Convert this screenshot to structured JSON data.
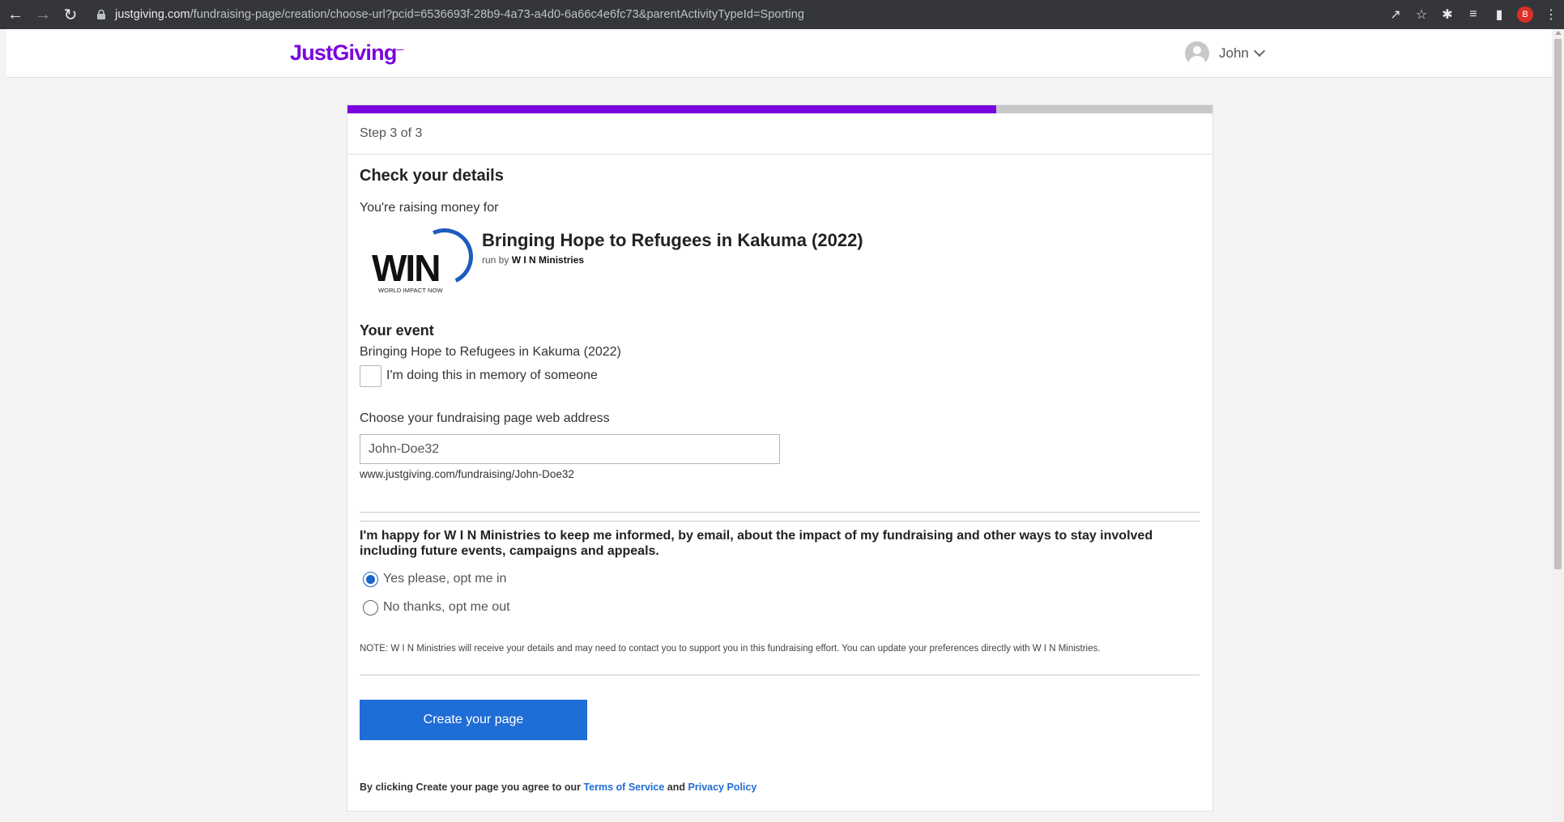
{
  "browser": {
    "url_host": "justgiving.com",
    "url_path": "/fundraising-page/creation/choose-url?pcid=6536693f-28b9-4a73-a4d0-6a66c4e6fc73&parentActivityTypeId=Sporting",
    "profile_initial": "B"
  },
  "header": {
    "logo": "JustGiving",
    "user_name": "John"
  },
  "progress": {
    "fraction": 0.75
  },
  "step_label": "Step 3 of 3",
  "title": "Check your details",
  "raising_label": "You're raising money for",
  "charity": {
    "logo_text": "WIN",
    "logo_subtext": "WORLD IMPACT NOW",
    "campaign_title": "Bringing Hope to Refugees in Kakuma (2022)",
    "run_by_prefix": "run by",
    "run_by_name": "W I N Ministries"
  },
  "event": {
    "label": "Your event",
    "name": "Bringing Hope to Refugees in Kakuma (2022)",
    "memory_label": "I'm doing this in memory of someone"
  },
  "web_address": {
    "label": "Choose your fundraising page web address",
    "value": "John-Doe32",
    "preview": "www.justgiving.com/fundraising/John-Doe32"
  },
  "optin": {
    "text": "I'm happy for W I N Ministries to keep me informed, by email, about the impact of my fundraising and other ways to stay involved including future events, campaigns and appeals.",
    "yes_label": "Yes please, opt me in",
    "no_label": "No thanks, opt me out"
  },
  "note": "NOTE: W I N Ministries will receive your details and may need to contact you to support you in this fundraising effort. You can update your preferences directly with W I N Ministries.",
  "create_button": "Create your page",
  "terms": {
    "prefix": "By clicking Create your page you agree to our",
    "tos": "Terms of Service",
    "and": "and",
    "privacy": "Privacy Policy"
  },
  "colors": {
    "brand": "#7a04dd",
    "button": "#1f6dd6",
    "radio_checked": "#1a65c9"
  }
}
